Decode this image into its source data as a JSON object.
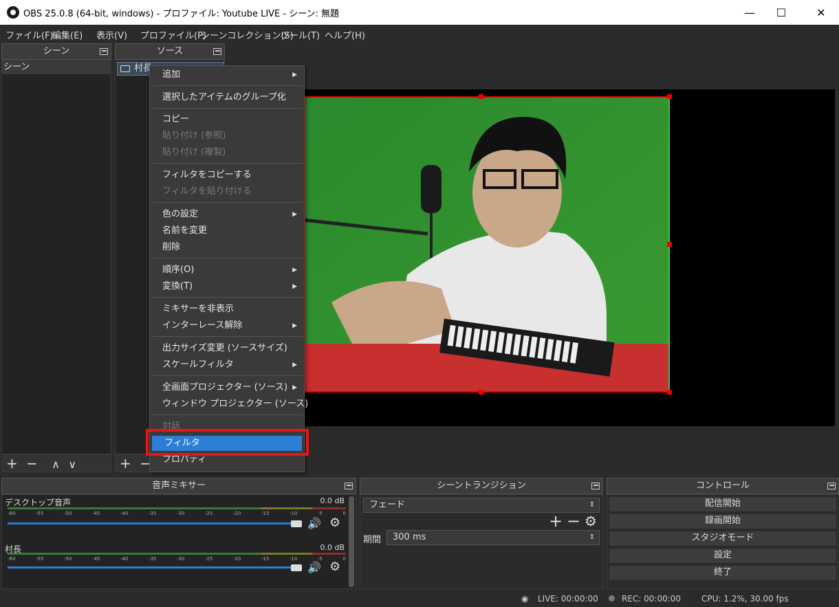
{
  "window": {
    "title": "OBS 25.0.8 (64-bit, windows) - プロファイル: Youtube LIVE - シーン: 無題",
    "minimize": "—",
    "maximize": "☐",
    "close": "✕"
  },
  "menu": [
    "ファイル(F)",
    "編集(E)",
    "表示(V)",
    "プロファイル(P)",
    "シーンコレクション(S)",
    "ツール(T)",
    "ヘルプ(H)"
  ],
  "scenes": {
    "header": "シーン",
    "items": [
      "シーン"
    ]
  },
  "sources": {
    "header": "ソース",
    "items": [
      "村長"
    ]
  },
  "context_menu": [
    {
      "label": "追加",
      "submenu": true,
      "disabled": false
    },
    {
      "label": "選択したアイテムのグループ化",
      "disabled": false
    },
    {
      "label": "コピー",
      "disabled": false
    },
    {
      "label": "貼り付け (参照)",
      "disabled": true
    },
    {
      "label": "貼り付け (複製)",
      "disabled": true
    },
    {
      "label": "フィルタをコピーする",
      "disabled": false
    },
    {
      "label": "フィルタを貼り付ける",
      "disabled": true
    },
    {
      "label": "色の設定",
      "submenu": true,
      "disabled": false
    },
    {
      "label": "名前を変更",
      "disabled": false
    },
    {
      "label": "削除",
      "disabled": false
    },
    {
      "label": "順序(O)",
      "submenu": true,
      "disabled": false
    },
    {
      "label": "変換(T)",
      "submenu": true,
      "disabled": false
    },
    {
      "label": "ミキサーを非表示",
      "disabled": false
    },
    {
      "label": "インターレース解除",
      "submenu": true,
      "disabled": false
    },
    {
      "label": "出力サイズ変更 (ソースサイズ)",
      "disabled": false
    },
    {
      "label": "スケールフィルタ",
      "submenu": true,
      "disabled": false
    },
    {
      "label": "全画面プロジェクター (ソース)",
      "submenu": true,
      "disabled": false
    },
    {
      "label": "ウィンドウ プロジェクター (ソース)",
      "disabled": false
    },
    {
      "label": "対話",
      "disabled": true
    },
    {
      "label": "フィルタ",
      "disabled": false,
      "selected": true
    },
    {
      "label": "プロパティ",
      "disabled": false
    }
  ],
  "mixer": {
    "header": "音声ミキサー",
    "tracks": [
      {
        "name": "デスクトップ音声",
        "db": "0.0 dB",
        "level": 1.0
      },
      {
        "name": "村長",
        "db": "0.0 dB",
        "level": 1.0
      }
    ],
    "scale": [
      "-60",
      "-55",
      "-50",
      "-45",
      "-40",
      "-35",
      "-30",
      "-25",
      "-20",
      "-15",
      "-10",
      "-5",
      "0"
    ]
  },
  "transition": {
    "header": "シーントランジション",
    "type": "フェード",
    "duration_label": "期間",
    "duration": "300 ms"
  },
  "controls": {
    "header": "コントロール",
    "buttons": [
      "配信開始",
      "録画開始",
      "スタジオモード",
      "設定",
      "終了"
    ]
  },
  "status": {
    "live": "LIVE: 00:00:00",
    "rec": "REC: 00:00:00",
    "cpu": "CPU: 1.2%, 30.00 fps"
  },
  "colors": {
    "selection": "#2d7fd6",
    "highlight": "#e01818",
    "greenscreen": "#2f8a2f"
  }
}
